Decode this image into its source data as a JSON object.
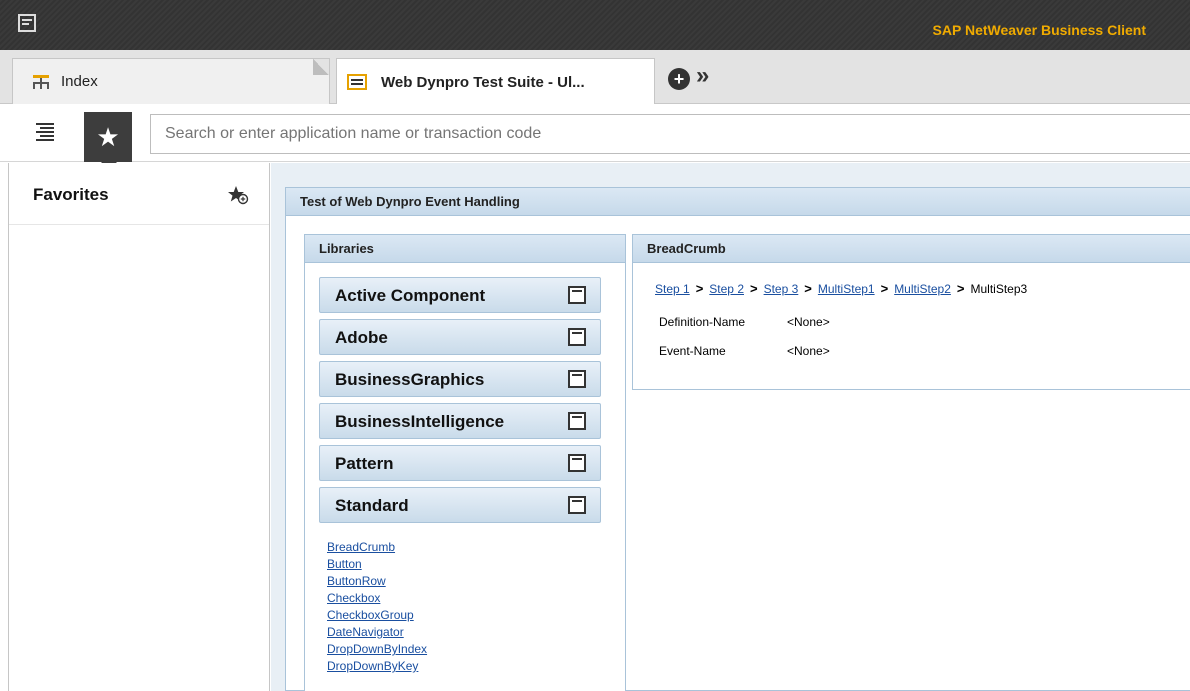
{
  "app": {
    "title": "SAP NetWeaver Business Client"
  },
  "tabs": [
    {
      "label": "Index",
      "icon": "sitemap-icon"
    },
    {
      "label": "Web Dynpro Test Suite - Ul...",
      "icon": "list-icon",
      "active": true
    }
  ],
  "tab_controls": {
    "add_icon": "plus-circle-icon",
    "more_icon": "double-chevron-right-icon",
    "add_label": "+",
    "more_label": "»"
  },
  "toolbar": {
    "search_placeholder": "Search or enter application name or transaction code",
    "fav_icon_glyph": "★"
  },
  "favorites": {
    "title": "Favorites"
  },
  "main": {
    "title": "Test of Web Dynpro Event Handling",
    "libraries_title": "Libraries",
    "libraries": [
      {
        "label": "Active Component",
        "expanded": false
      },
      {
        "label": "Adobe",
        "expanded": false
      },
      {
        "label": "BusinessGraphics",
        "expanded": false
      },
      {
        "label": "BusinessIntelligence",
        "expanded": false
      },
      {
        "label": "Pattern",
        "expanded": false
      },
      {
        "label": "Standard",
        "expanded": true
      }
    ],
    "standard_links": [
      "BreadCrumb",
      "Button",
      "ButtonRow",
      "Checkbox",
      "CheckboxGroup",
      "DateNavigator",
      "DropDownByIndex",
      "DropDownByKey"
    ],
    "breadcrumb_title": "BreadCrumb",
    "crumbs": [
      "Step 1",
      "Step 2",
      "Step 3",
      "MultiStep1",
      "MultiStep2"
    ],
    "crumb_current": "MultiStep3",
    "crumb_separator": ">",
    "definition_label": "Definition-Name",
    "definition_value": "<None>",
    "event_label": "Event-Name",
    "event_value": "<None>"
  },
  "colors": {
    "brand": "#f0ab00",
    "link": "#1a4fa0",
    "panel_header": "#c6d9ea"
  }
}
